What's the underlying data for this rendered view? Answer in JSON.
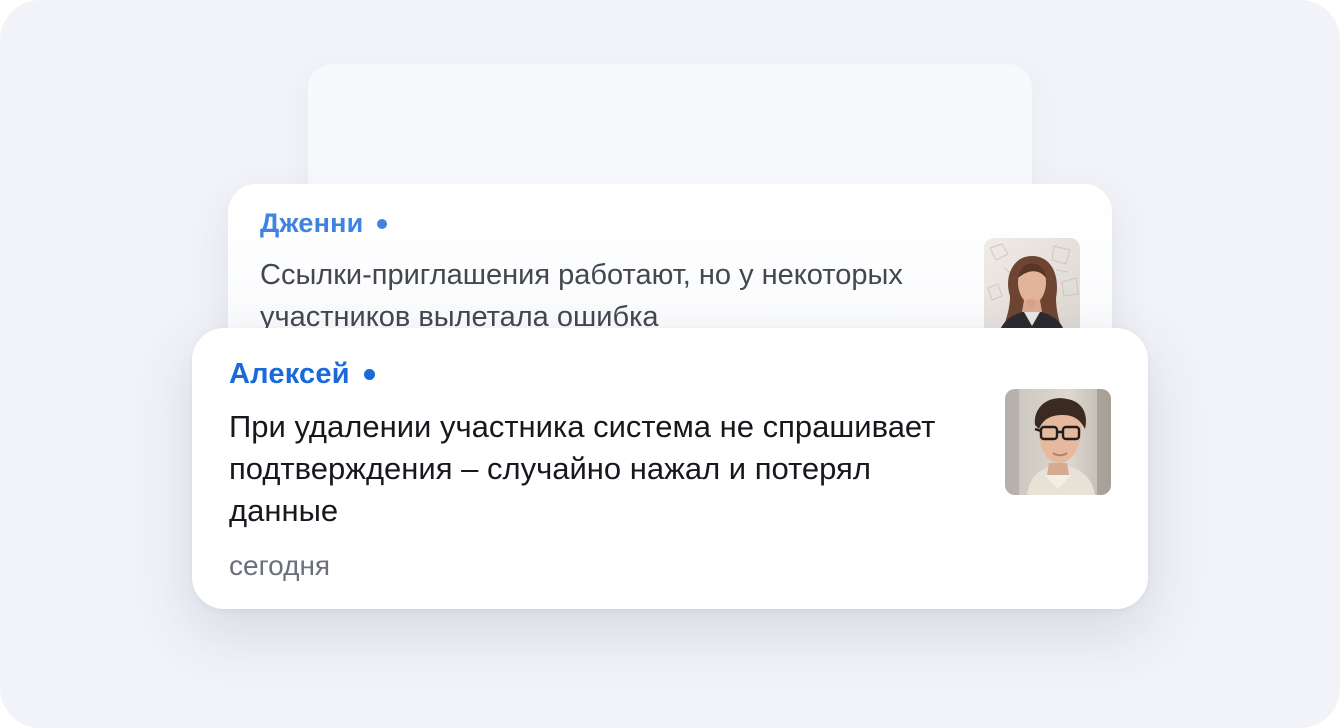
{
  "messages": [
    {
      "author": "Дженни",
      "text": "Ссылки-приглашения работают, но у некоторых участников вылетала ошибка",
      "avatar_icon": "woman-photo-avatar",
      "accent": "#3f83e0"
    },
    {
      "author": "Алексей",
      "text": "При удалении участника система не спрашивает подтверждения – случайно нажал и потерял данные",
      "time": "сегодня",
      "avatar_icon": "man-with-glasses-photo-avatar",
      "accent": "#1a6ad8"
    }
  ],
  "colors": {
    "background": "#f2f3f8",
    "card": "#ffffff",
    "secondary_text": "#6b707c"
  }
}
